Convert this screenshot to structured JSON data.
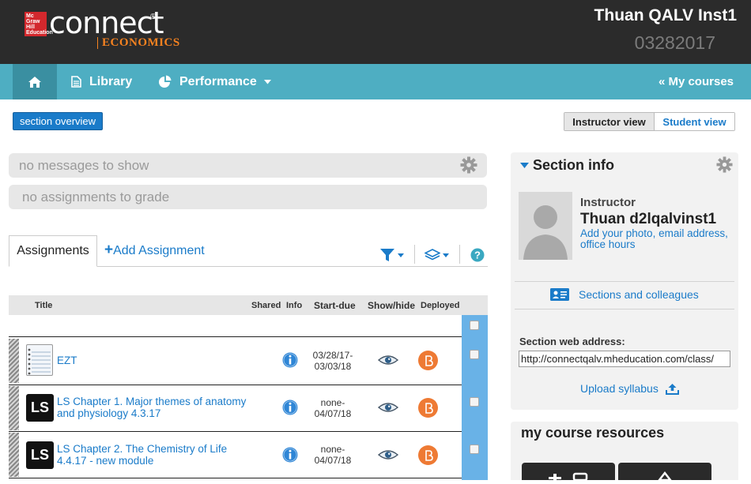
{
  "header": {
    "logo_text": "Mc Graw Hill Education",
    "brand": "connect",
    "brand_reg": "®",
    "brand_sub": "ECONOMICS",
    "user_name": "Thuan QALV Inst1",
    "user_code": "03282017"
  },
  "nav": {
    "library": "Library",
    "performance": "Performance",
    "my_courses": "« My courses"
  },
  "toolbar": {
    "section_overview": "section overview",
    "instructor_view": "Instructor view",
    "student_view": "Student view"
  },
  "messages": {
    "no_messages": "no messages to show",
    "no_assignments": "no assignments to grade"
  },
  "assignments": {
    "tab_label": "Assignments",
    "add_label": "Add Assignment",
    "add_plus": "+",
    "columns": {
      "title": "Title",
      "shared": "Shared",
      "info": "Info",
      "start_due": "Start-due",
      "show_hide": "Show/hide",
      "deployed": "Deployed"
    },
    "rows": [
      {
        "thumb": "notebook",
        "title": "EZT",
        "date1": "03/28/17-",
        "date2": "03/03/18"
      },
      {
        "thumb": "LS",
        "title": "LS Chapter 1. Major themes of anatomy and physiology 4.3.17",
        "date1": "none-",
        "date2": "04/07/18"
      },
      {
        "thumb": "LS",
        "title": "LS Chapter 2. The Chemistry of Life 4.4.17 - new module",
        "date1": "none-",
        "date2": "04/07/18"
      }
    ]
  },
  "section_info": {
    "title": "Section info",
    "instructor_label": "Instructor",
    "instructor_name": "Thuan d2lqalvinst1",
    "instructor_link": "Add your photo, email address, office hours",
    "sections_link": "Sections and colleagues",
    "web_label": "Section web address:",
    "web_value": "http://connectqalv.mheducation.com/class/",
    "upload": "Upload syllabus"
  },
  "resources": {
    "title": "my course resources"
  },
  "colors": {
    "header_bg": "#2b2b2b",
    "nav_bg": "#4eaec2",
    "link": "#1a7bc9",
    "brand_orange": "#f58220",
    "deployed_orange": "#ee7a34"
  }
}
